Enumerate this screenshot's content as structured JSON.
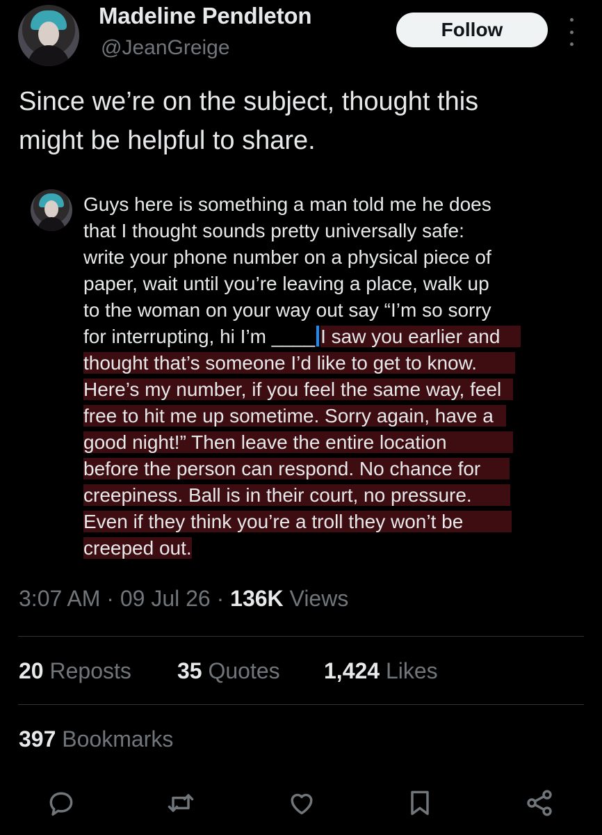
{
  "author": {
    "name": "Madeline Pendleton",
    "handle": "@JeanGreige",
    "follow_label": "Follow"
  },
  "post": {
    "text_lines": [
      "Since we’re on the subject, thought this",
      "might be helpful to share."
    ]
  },
  "quoted": {
    "lines": [
      "Guys here is something a man told me he does",
      "that I thought sounds pretty universally safe:",
      "write your phone number on a physical piece of",
      "paper, wait until you’re leaving a place, walk up",
      "to the woman on your way out say “I’m so sorry",
      "for interrupting, hi I’m ____",
      "I saw you earlier and",
      "thought that’s someone I’d like to get to know.",
      "Here’s my number, if you feel the same way, feel",
      "free to hit me up sometime. Sorry again, have a",
      "good night!” Then leave the entire location",
      "before the person can respond. No chance for",
      "creepiness. Ball is in their court, no pressure.",
      "Even if they think you’re a troll they won’t be",
      "creeped out."
    ]
  },
  "meta": {
    "time": "3:07 AM",
    "sep": "·",
    "date": "09 Jul 26",
    "views_count": "136K",
    "views_label": "Views"
  },
  "stats": {
    "reposts_count": "20",
    "reposts_label": "Reposts",
    "quotes_count": "35",
    "quotes_label": "Quotes",
    "likes_count": "1,424",
    "likes_label": "Likes",
    "bookmarks_count": "397",
    "bookmarks_label": "Bookmarks"
  },
  "icons": [
    "reply-icon",
    "repost-icon",
    "like-icon",
    "bookmark-icon",
    "share-icon"
  ],
  "colors": {
    "background": "#000000",
    "text": "#e7e9ea",
    "secondary": "#71767b",
    "highlight": "#3d0d12",
    "cursor": "#1d8bf0"
  }
}
